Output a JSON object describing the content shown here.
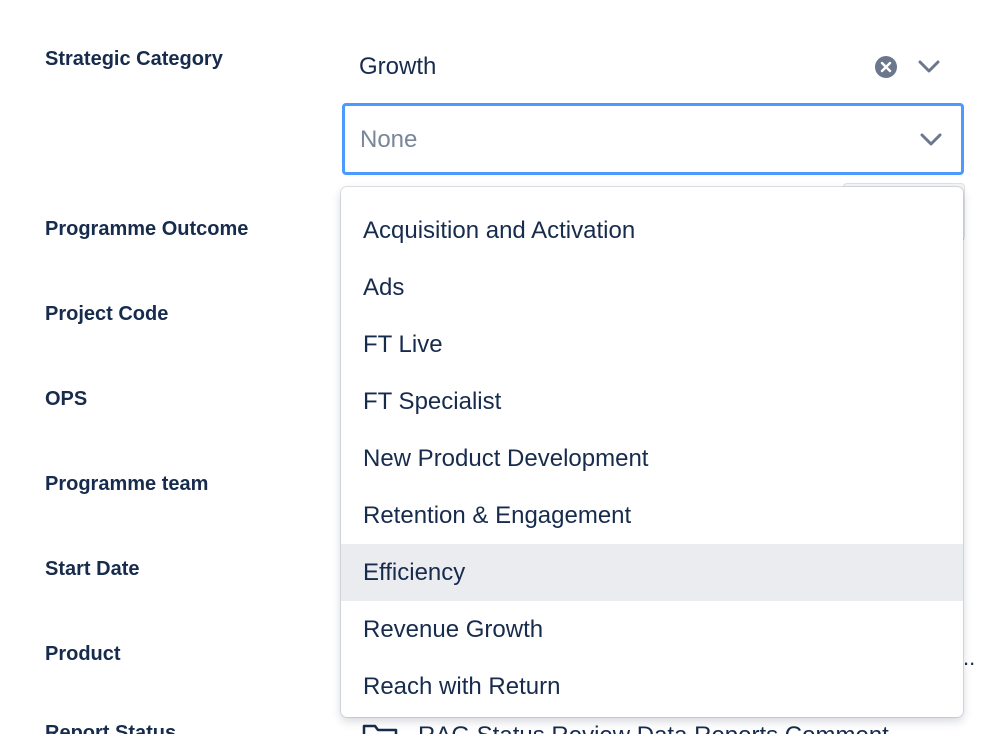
{
  "labels": {
    "strategic_category": "Strategic Category",
    "programme_outcome": "Programme Outcome",
    "project_code": "Project Code",
    "ops": "OPS",
    "programme_team": "Programme team",
    "start_date": "Start Date",
    "product": "Product",
    "report_status": "Report Status"
  },
  "strategic_category": {
    "value": "Growth",
    "select_placeholder": "None"
  },
  "dropdown": {
    "options": [
      "Acquisition and Activation",
      "Ads",
      "FT Live",
      "FT Specialist",
      "New Product Development",
      "Retention & Engagement",
      "Efficiency",
      "Revenue Growth",
      "Reach with Return"
    ],
    "highlighted": "Efficiency"
  },
  "product_value_overflow": "..",
  "report_status_link": "RAG Status Review Data Reports Comment",
  "icons": {
    "clear": "clear-icon",
    "chevron": "chevron-down-icon",
    "folder": "folder-icon"
  },
  "colors": {
    "focus_border": "#4c9aff",
    "text": "#172b4d",
    "placeholder": "#7a869a",
    "highlight": "#ebecf0",
    "icon_grey": "#6b778c"
  }
}
